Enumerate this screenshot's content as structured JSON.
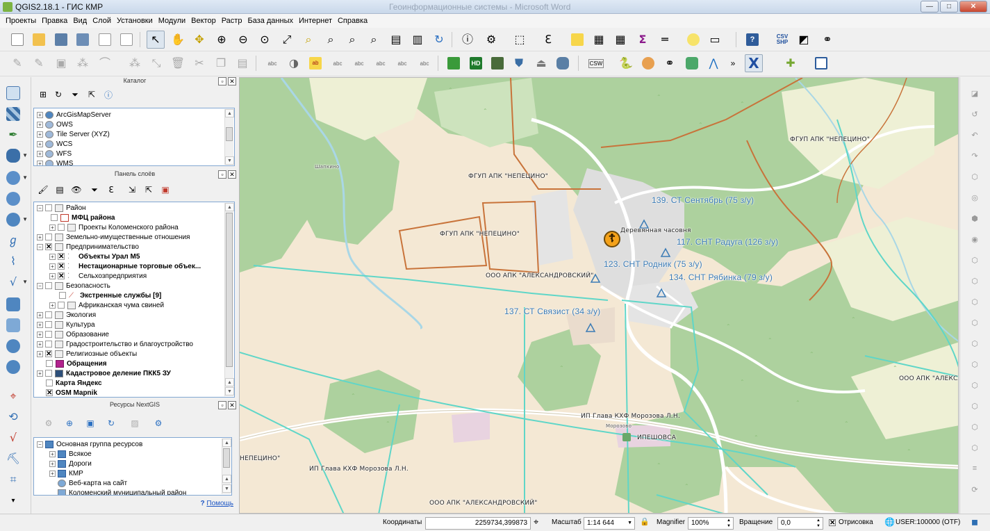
{
  "window": {
    "title": "QGIS2.18.1 - ГИС КМР",
    "background_title": "Геоинформационные системы - Microsoft Word",
    "buttons": {
      "minimize": "—",
      "maximize": "□",
      "close": "✕"
    }
  },
  "menu": [
    "Проекты",
    "Правка",
    "Вид",
    "Слой",
    "Установки",
    "Модули",
    "Вектор",
    "Растр",
    "База данных",
    "Интернет",
    "Справка"
  ],
  "catalog": {
    "title": "Каталог",
    "items": [
      "ArcGisMapServer",
      "OWS",
      "Tile Server (XYZ)",
      "WCS",
      "WFS",
      "WMS"
    ]
  },
  "layers_panel": {
    "title": "Панель слоёв",
    "rows": [
      {
        "label": "Район",
        "bold": false,
        "indent": 0,
        "checked": false
      },
      {
        "label": "МФЦ района",
        "bold": true,
        "indent": 1,
        "checked": false
      },
      {
        "label": "Проекты Коломенского района",
        "bold": false,
        "indent": 1,
        "checked": false
      },
      {
        "label": "Земельно-имущественные отношения",
        "bold": false,
        "indent": 0,
        "checked": false
      },
      {
        "label": "Предпринимательство",
        "bold": false,
        "indent": 0,
        "checked": true
      },
      {
        "label": "Объекты Урал М5",
        "bold": true,
        "indent": 1,
        "checked": true
      },
      {
        "label": "Нестационарные торговые объек...",
        "bold": true,
        "indent": 1,
        "checked": true
      },
      {
        "label": "Сельхозпредприятия",
        "bold": false,
        "indent": 1,
        "checked": true
      },
      {
        "label": "Безопасность",
        "bold": false,
        "indent": 0,
        "checked": false
      },
      {
        "label": "Экстренные службы [9]",
        "bold": true,
        "indent": 1,
        "checked": false
      },
      {
        "label": "Африканская чума свиней",
        "bold": false,
        "indent": 1,
        "checked": false
      },
      {
        "label": "Экология",
        "bold": false,
        "indent": 0,
        "checked": false
      },
      {
        "label": "Культура",
        "bold": false,
        "indent": 0,
        "checked": false
      },
      {
        "label": "Образование",
        "bold": false,
        "indent": 0,
        "checked": false
      },
      {
        "label": "Градостроительство и благоустройство",
        "bold": false,
        "indent": 0,
        "checked": false
      },
      {
        "label": "Религиозные объекты",
        "bold": false,
        "indent": 0,
        "checked": true
      },
      {
        "label": "Обращения",
        "bold": true,
        "indent": 0,
        "checked": false
      },
      {
        "label": "Кадастровое деление ПКК5 ЗУ",
        "bold": true,
        "indent": 0,
        "checked": false
      },
      {
        "label": "Карта Яндекс",
        "bold": true,
        "indent": 0,
        "checked": false
      },
      {
        "label": "OSM Mapnik",
        "bold": true,
        "indent": 0,
        "checked": true
      }
    ]
  },
  "nextgis_panel": {
    "title": "Ресурсы NextGIS",
    "items": [
      {
        "label": "Основная группа ресурсов",
        "indent": 0
      },
      {
        "label": "Всякое",
        "indent": 1
      },
      {
        "label": "Дороги",
        "indent": 1
      },
      {
        "label": "КМР",
        "indent": 1
      },
      {
        "label": "Веб-карта на сайт",
        "indent": 1
      },
      {
        "label": "Коломенский муниципальный район",
        "indent": 1
      }
    ],
    "help": "Помощь"
  },
  "map": {
    "labels": {
      "fgup1": "ФГУП АПК \"НЕПЕЦИНО\"",
      "fgup2": "ФГУП АПК \"НЕПЕЦИНО\"",
      "fgup3": "ФГУП АПК \"НЕПЕЦИНО\"",
      "nepecino_edge": "НЕПЕЦИНО\"",
      "ooo1": "ООО АПК \"АЛЕКСАНДРОВСКИЙ\"",
      "ooo2": "ООО АПК \"АЛЕКСАНДРОВСКИЙ\"",
      "ooo_edge": "ООО АПК \"АЛЕКСА",
      "ip1": "ИП Глава КХФ Морозова Л.Н.",
      "ip2": "ИП Глава КХФ Морозова Л.Н.",
      "chapel": "Деревянная часовня",
      "snt139": "139. СТ Сентябрь (75 з/у)",
      "snt117": "117. СНТ Радуга (126 з/у)",
      "snt123": "123. СНТ Родник (75 з/у)",
      "snt134": "134. СНТ Рябинка (79 з/у)",
      "st137": "137. СТ Связист (34 з/у)",
      "ipeshovsa": "ИПЕШОВСА",
      "shapkino": "Шапкино",
      "morozovo": "Морозово"
    },
    "colors": {
      "forest": "#add19e",
      "farmland": "#eef0d5",
      "residential": "#e0dfdf",
      "background": "#f4e8d4",
      "boundary_orange": "#c8733a",
      "boundary_teal": "#5fd6c8",
      "poi_blue": "#3b7bb5"
    }
  },
  "status": {
    "coords_label": "Координаты",
    "coords_value": "2259734,399873",
    "scale_label": "Масштаб",
    "scale_value": "1:14 644",
    "magnifier_label": "Magnifier",
    "magnifier_value": "100%",
    "rotation_label": "Вращение",
    "rotation_value": "0,0",
    "render_label": "Отрисовка",
    "crs": "USER:100000 (OTF)"
  }
}
